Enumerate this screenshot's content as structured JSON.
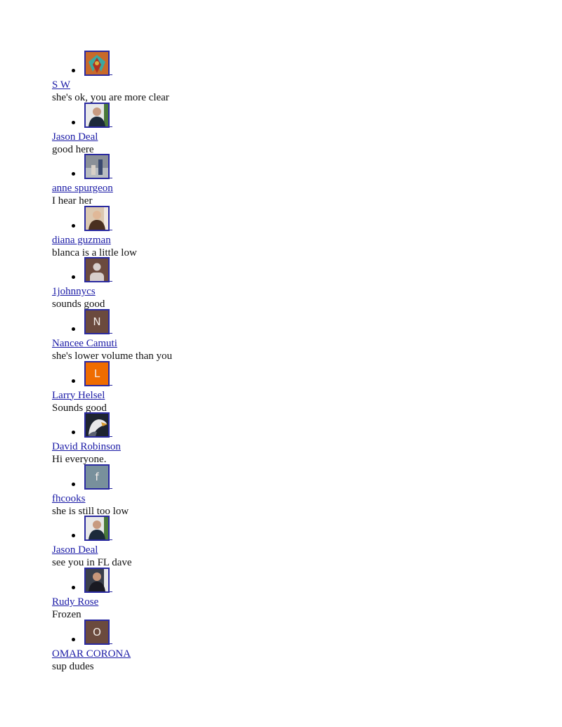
{
  "comments": [
    {
      "name": "S W",
      "text": "she's ok, you are more clear",
      "avatar": {
        "type": "photo",
        "icon": "butterfly-art-photo",
        "colors": [
          "#c86a2a",
          "#3aa8a0",
          "#d8b040",
          "#b03020"
        ]
      }
    },
    {
      "name": "Jason Deal",
      "text": "good here",
      "avatar": {
        "type": "photo",
        "icon": "man-portrait-photo",
        "colors": [
          "#e8e8e8",
          "#1c2a3a",
          "#c79a80",
          "#4a7a3a"
        ]
      }
    },
    {
      "name": "anne spurgeon",
      "text": "I hear her",
      "avatar": {
        "type": "photo",
        "icon": "family-outdoor-photo",
        "colors": [
          "#8a9098",
          "#b8bcc0",
          "#3a4a70",
          "#d8d0c8"
        ]
      }
    },
    {
      "name": "diana guzman",
      "text": "blanca is a little low",
      "avatar": {
        "type": "photo",
        "icon": "woman-portrait-photo",
        "colors": [
          "#dcc8b0",
          "#4a3020",
          "#e0b898",
          "#f0e8e0"
        ]
      }
    },
    {
      "name": "1johnnycs",
      "text": "sounds good",
      "avatar": {
        "type": "placeholder",
        "icon": "default-person-icon",
        "bg": "#6b4a3e",
        "fg": "#d8cfcc"
      }
    },
    {
      "name": "Nancee Camuti",
      "text": "she's lower volume than you",
      "avatar": {
        "type": "letter",
        "letter": "N",
        "bg": "#6b4a3e"
      }
    },
    {
      "name": "Larry Helsel",
      "text": "Sounds good",
      "avatar": {
        "type": "letter",
        "letter": "L",
        "bg": "#ef6c00"
      }
    },
    {
      "name": "David Robinson",
      "text": "Hi everyone.",
      "avatar": {
        "type": "photo",
        "icon": "eagle-photo",
        "colors": [
          "#1e2430",
          "#e8e8ea",
          "#d89a30",
          "#5a6070"
        ]
      }
    },
    {
      "name": "fhcooks",
      "text": "she is still too low",
      "avatar": {
        "type": "letter",
        "letter": "f",
        "bg": "#78909c"
      }
    },
    {
      "name": "Jason Deal",
      "text": "see you in FL dave",
      "avatar": {
        "type": "photo",
        "icon": "man-portrait-photo",
        "colors": [
          "#e8e8e8",
          "#1c2a3a",
          "#c79a80",
          "#4a7a3a"
        ]
      }
    },
    {
      "name": "Rudy Rose",
      "text": "Frozen",
      "avatar": {
        "type": "photo",
        "icon": "man-suit-photo",
        "colors": [
          "#3a3f4a",
          "#1a1a22",
          "#c9987a",
          "#e8e8e8"
        ]
      }
    },
    {
      "name": "OMAR CORONA",
      "text": "sup dudes",
      "avatar": {
        "type": "letter",
        "letter": "O",
        "bg": "#6b4a3e"
      }
    }
  ]
}
